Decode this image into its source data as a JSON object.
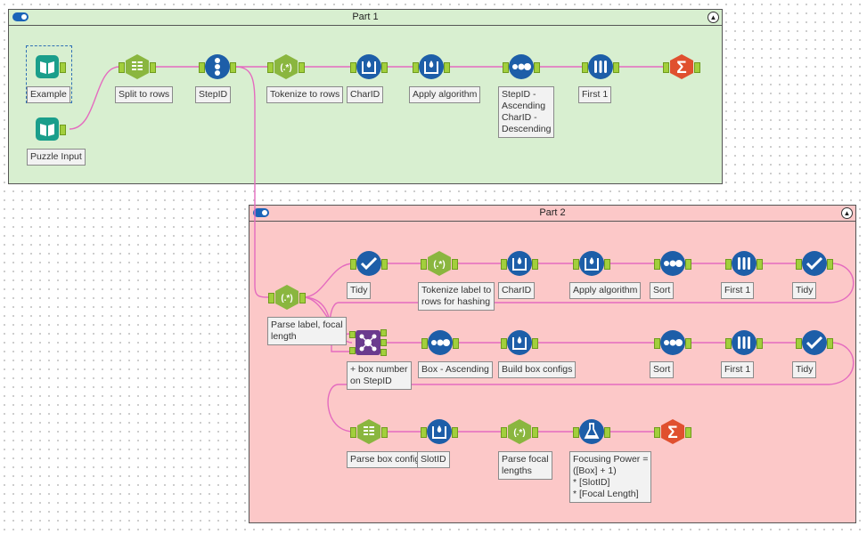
{
  "containers": {
    "part1": {
      "title": "Part 1"
    },
    "part2": {
      "title": "Part 2"
    }
  },
  "tools": {
    "example": "Example",
    "puzzle_input": "Puzzle Input",
    "split_rows": "Split to rows",
    "stepid": "StepID",
    "tokenize_rows": "Tokenize to rows",
    "charid1": "CharID",
    "apply_alg1": "Apply algorithm",
    "sort_note": "StepID -\nAscending\nCharID -\nDescending",
    "first1": "First 1",
    "parse_label": "Parse label, focal\nlength",
    "tidy1": "Tidy",
    "tokenize_label": "Tokenize label  to\nrows for hashing",
    "charid2": "CharID",
    "apply_alg2": "Apply algorithm",
    "sort2": "Sort",
    "first2": "First 1",
    "tidy2": "Tidy",
    "box_number": "+ box number\non StepID",
    "box_asc": "Box - Ascending",
    "build_box": "Build box configs",
    "sort3": "Sort",
    "first3": "First 1",
    "tidy3": "Tidy",
    "parse_box": "Parse box configs",
    "slotid": "SlotID",
    "parse_focal": "Parse focal\nlengths",
    "focusing_power": "Focusing Power =\n([Box] + 1)\n* [SlotID]\n* [Focal Length]"
  },
  "colors": {
    "blue": "#1d5ea8",
    "teal": "#1a9e8b",
    "green": "#8ab63f",
    "purple": "#6b3b8e",
    "orange": "#e0502f",
    "wire": "#e46bbf"
  },
  "icons": {
    "input": "book-icon",
    "text_to_columns": "text-to-columns-icon",
    "record_id": "record-id-icon",
    "regex": "regex-icon",
    "multi_row": "multi-row-formula-icon",
    "sort": "sort-icon",
    "sample": "sample-icon",
    "summarize": "summarize-sigma-icon",
    "select": "select-checkmark-icon",
    "join": "join-multiple-icon",
    "formula": "formula-flask-icon"
  }
}
